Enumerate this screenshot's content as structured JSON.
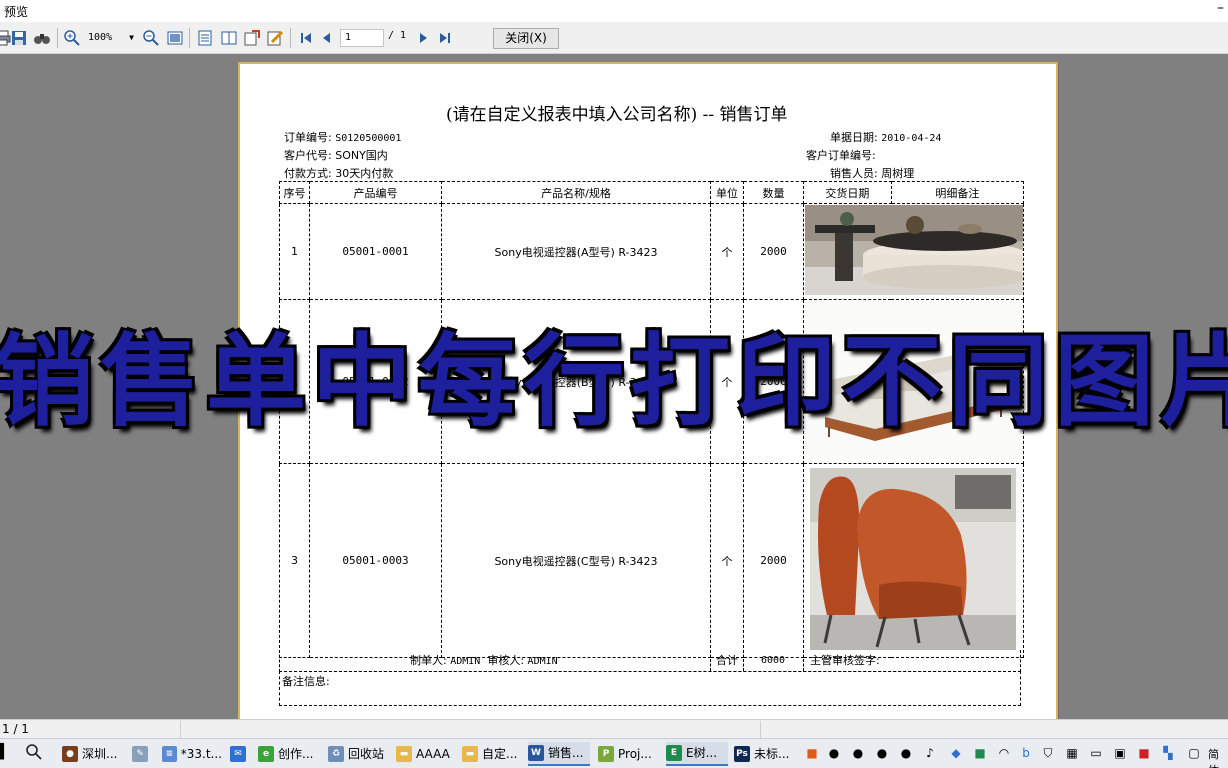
{
  "window": {
    "title": "预览",
    "minimize_glyph": "–"
  },
  "toolbar": {
    "zoom_value": "100%",
    "page_current": "1",
    "page_total": "/ 1",
    "close_label": "关闭(X)",
    "icons": [
      "print-icon",
      "save-icon",
      "find-icon",
      "zoom-in-icon",
      "zoom-out-icon",
      "fit-page-icon",
      "single-page-icon",
      "two-page-icon",
      "export-icon",
      "edit-icon",
      "first-page-icon",
      "prev-page-icon",
      "next-page-icon",
      "last-page-icon"
    ]
  },
  "report": {
    "title": "(请在自定义报表中填入公司名称)   --   销售订单",
    "order_no_label": "订单编号:",
    "order_no": "S0120500001",
    "customer_label": "客户代号:",
    "customer": "SONY国内",
    "payment_label": "付款方式:",
    "payment": "30天内付款",
    "date_label": "单据日期:",
    "date": "2010-04-24",
    "cust_order_label": "客户订单编号:",
    "cust_order": "",
    "salesperson_label": "销售人员:",
    "salesperson": "周树理",
    "columns": [
      "序号",
      "产品编号",
      "产品名称/规格",
      "单位",
      "数量",
      "交货日期",
      "明细备注"
    ],
    "rows": [
      {
        "no": "1",
        "code": "05001-0001",
        "name": "Sony电视遥控器(A型号) R-3423",
        "unit": "个",
        "qty": "2000",
        "image": "round-coffee-table-photo"
      },
      {
        "no": "2",
        "code": "05001-0002",
        "name": "Sony电视遥控器(B型号) R-3423",
        "unit": "个",
        "qty": "2000",
        "image": "sectional-sofa-photo"
      },
      {
        "no": "3",
        "code": "05001-0003",
        "name": "Sony电视遥控器(C型号) R-3423",
        "unit": "个",
        "qty": "2000",
        "image": "orange-armchair-photo"
      }
    ],
    "maker_label": "制单人:",
    "maker": "ADMIN",
    "auditor_label": "审核人:",
    "auditor": "ADMIN",
    "total_label": "合计",
    "total": "6000",
    "supervisor_label": "主管审核签字:",
    "remark_label": "备注信息:"
  },
  "overlay_caption": "销售单中每行打印不同图片",
  "statusbar": {
    "page": "1 / 1"
  },
  "taskbar": [
    {
      "label": "深圳...",
      "icon": "app-icon"
    },
    {
      "label": "",
      "icon": "brush-icon"
    },
    {
      "label": "*33.t...",
      "icon": "notepad-icon"
    },
    {
      "label": "",
      "icon": "mail-icon"
    },
    {
      "label": "创作...",
      "icon": "browser-icon"
    },
    {
      "label": "回收站",
      "icon": "recycle-bin-icon"
    },
    {
      "label": "AAAA",
      "icon": "folder-icon"
    },
    {
      "label": "自定...",
      "icon": "folder-icon"
    },
    {
      "label": "销售...",
      "icon": "word-icon"
    },
    {
      "label": "Proj...",
      "icon": "project-icon"
    },
    {
      "label": "E树...",
      "icon": "app-green-icon"
    },
    {
      "label": "未标...",
      "icon": "photoshop-icon"
    }
  ],
  "tray_text": "简体",
  "colors": {
    "title_accent": "#1e1f9c",
    "paper_border": "#d8b45a",
    "workspace": "#808080"
  }
}
